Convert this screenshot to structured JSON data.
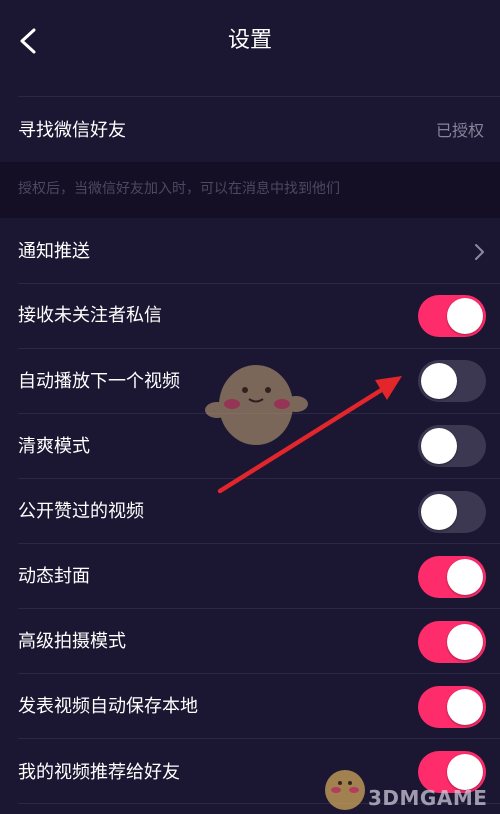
{
  "header": {
    "title": "设置",
    "back_icon": "chevron-left-icon"
  },
  "wechat": {
    "label": "寻找微信好友",
    "status": "已授权",
    "hint": "授权后，当微信好友加入时，可以在消息中找到他们"
  },
  "notification": {
    "label": "通知推送",
    "icon": "chevron-right-icon"
  },
  "toggles": [
    {
      "label": "接收未关注者私信",
      "on": true
    },
    {
      "label": "自动播放下一个视频",
      "on": false
    },
    {
      "label": "清爽模式",
      "on": false
    },
    {
      "label": "公开赞过的视频",
      "on": false
    },
    {
      "label": "动态封面",
      "on": true
    },
    {
      "label": "高级拍摄模式",
      "on": true
    },
    {
      "label": "发表视频自动保存本地",
      "on": true
    },
    {
      "label": "我的视频推荐给好友",
      "on": true
    }
  ],
  "colors": {
    "background": "#1b1631",
    "accent": "#fe2c6a",
    "toggle_off": "#3c3852",
    "arrow": "#e3252c"
  },
  "watermark": {
    "text": "3DMGAME"
  }
}
